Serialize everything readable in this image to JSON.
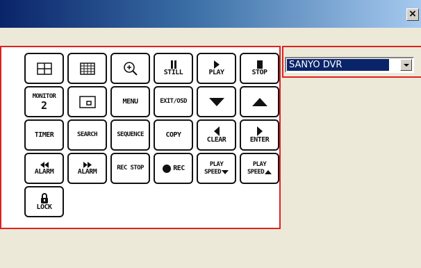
{
  "window": {
    "title": ""
  },
  "dvr_select": {
    "value": "SANYO DVR"
  },
  "buttons": {
    "split4": "",
    "split16": "",
    "zoom": "",
    "still": "STILL",
    "play": "PLAY",
    "stop": "STOP",
    "monitor_line1": "MONITOR",
    "monitor_line2": "2",
    "pip": "",
    "menu": "MENU",
    "exit_osd": "EXIT/OSD",
    "down": "",
    "up": "",
    "timer": "TIMER",
    "search": "SEARCH",
    "sequence": "SEQUENCE",
    "copy": "COPY",
    "clear": "CLEAR",
    "enter": "ENTER",
    "alarm_rew": "ALARM",
    "alarm_ff": "ALARM",
    "rec_stop": "REC STOP",
    "rec": "REC",
    "play_speed_down_line1": "PLAY",
    "play_speed_down_line2": "SPEED",
    "play_speed_up_line1": "PLAY",
    "play_speed_up_line2": "SPEED",
    "lock": "LOCK"
  }
}
